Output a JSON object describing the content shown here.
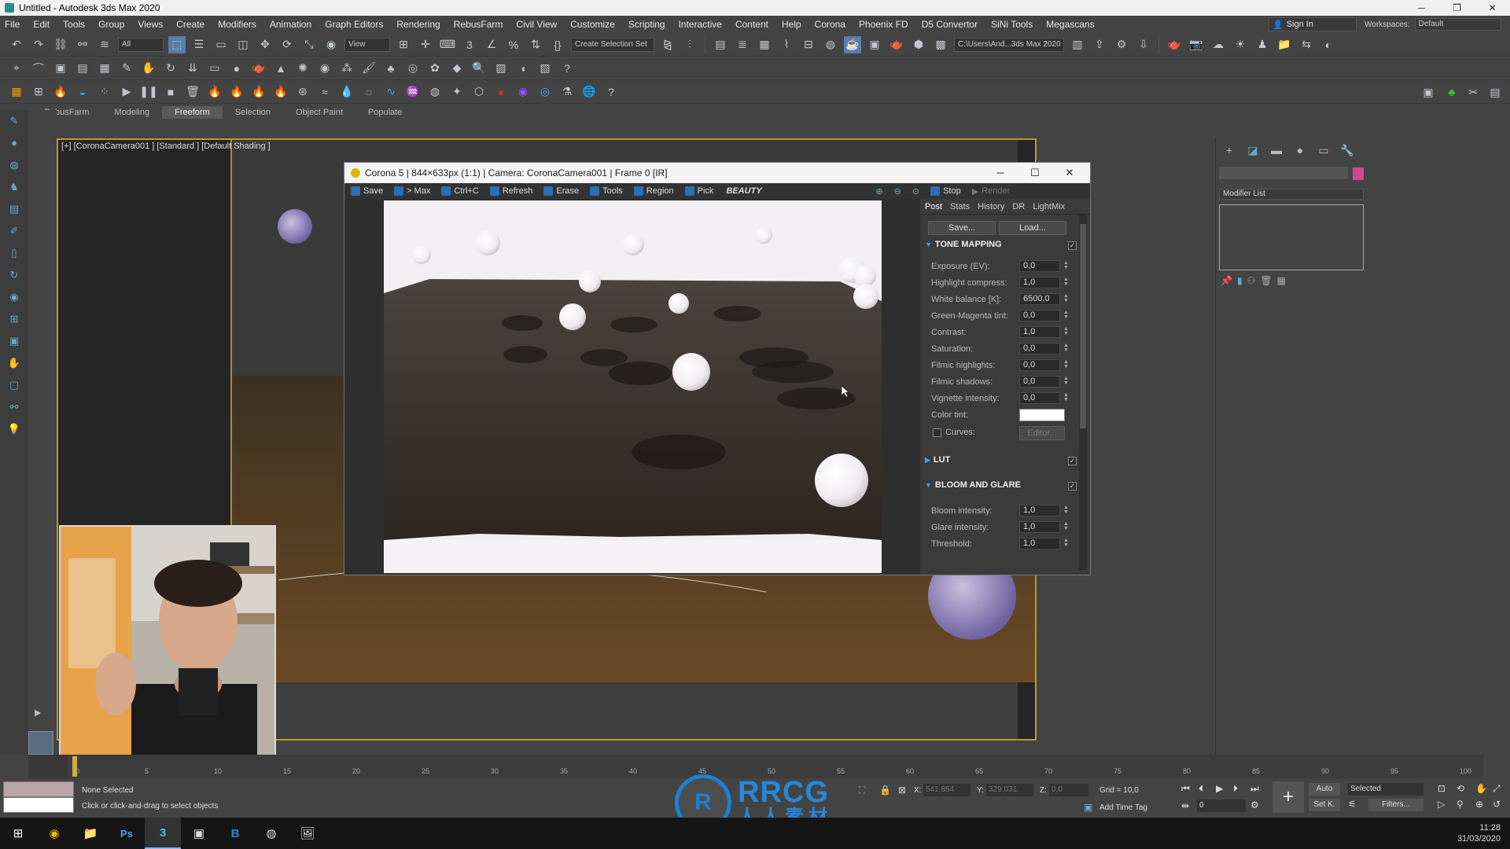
{
  "window": {
    "title": "Untitled - Autodesk 3ds Max 2020",
    "min": "─",
    "max": "❐",
    "close": "✕"
  },
  "menu": [
    "File",
    "Edit",
    "Tools",
    "Group",
    "Views",
    "Create",
    "Modifiers",
    "Animation",
    "Graph Editors",
    "Rendering",
    "RebusFarm",
    "Civil View",
    "Customize",
    "Scripting",
    "Interactive",
    "Content",
    "Help",
    "Corona",
    "Phoenix FD",
    "D5 Convertor",
    "SiNi Tools",
    "Megascans"
  ],
  "signin": "Sign In",
  "workspaces": {
    "label": "Workspaces:",
    "value": "Default"
  },
  "toolbar1": {
    "filter": "All",
    "view": "View",
    "selection_set": "Create Selection Set",
    "path": "C:\\Users\\And...3ds Max 2020"
  },
  "ribbon_tabs": [
    "RebusFarm",
    "Modeling",
    "Freeform",
    "Selection",
    "Object Paint",
    "Populate"
  ],
  "viewport": {
    "label": "[+] [CoronaCamera001 ] [Standard ] [Default Shading ]"
  },
  "command_panel": {
    "modifier_list": "Modifier List",
    "accent": "#d04a8a"
  },
  "vfb": {
    "title": "Corona 5 | 844×633px (1:1) | Camera: CoronaCamera001 | Frame 0 [IR]",
    "toolbar": {
      "save": "Save",
      "to_max": "> Max",
      "copy": "Ctrl+C",
      "refresh": "Refresh",
      "erase": "Erase",
      "tools": "Tools",
      "region": "Region",
      "pick": "Pick",
      "pass": "BEAUTY",
      "stop": "Stop",
      "render": "Render"
    },
    "tabs": [
      "Post",
      "Stats",
      "History",
      "DR",
      "LightMix"
    ],
    "save_btn": "Save...",
    "load_btn": "Load...",
    "tone_mapping": {
      "title": "TONE MAPPING",
      "params": [
        {
          "label": "Exposure (EV):",
          "value": "0,0"
        },
        {
          "label": "Highlight compress:",
          "value": "1,0"
        },
        {
          "label": "White balance [K]:",
          "value": "6500,0"
        },
        {
          "label": "Green-Magenta tint:",
          "value": "0,0"
        },
        {
          "label": "Contrast:",
          "value": "1,0"
        },
        {
          "label": "Saturation:",
          "value": "0,0"
        },
        {
          "label": "Filmic highlights:",
          "value": "0,0"
        },
        {
          "label": "Filmic shadows:",
          "value": "0,0"
        },
        {
          "label": "Vignette intensity:",
          "value": "0,0"
        }
      ],
      "color_tint": "Color tint:",
      "curves": "Curves:",
      "editor": "Editor..."
    },
    "lut": "LUT",
    "bloom": {
      "title": "BLOOM AND GLARE",
      "params": [
        {
          "label": "Bloom intensity:",
          "value": "1,0"
        },
        {
          "label": "Glare intensity:",
          "value": "1,0"
        },
        {
          "label": "Threshold:",
          "value": "1,0"
        }
      ]
    }
  },
  "timeline": {
    "ticks": [
      "0",
      "5",
      "10",
      "15",
      "20",
      "25",
      "30",
      "35",
      "40",
      "45",
      "50",
      "55",
      "60",
      "65",
      "70",
      "75",
      "80",
      "85",
      "90",
      "95",
      "100"
    ]
  },
  "status": {
    "selection": "None Selected",
    "prompt": "Click or click-and-drag to select objects",
    "x_label": "X:",
    "x": "541,864",
    "y_label": "Y:",
    "y": "329,031",
    "z_label": "Z:",
    "z": "0,0",
    "grid": "Grid = 10,0",
    "add_time_tag": "Add Time Tag",
    "auto": "Auto",
    "set_k": "Set K.",
    "selected": "Selected",
    "filters": "Filters...",
    "frame": "0"
  },
  "watermark": {
    "mark": "R",
    "brand": "RRCG",
    "sub": "人人素材"
  },
  "clock": {
    "time": "11:28",
    "date": "31/03/2020"
  }
}
